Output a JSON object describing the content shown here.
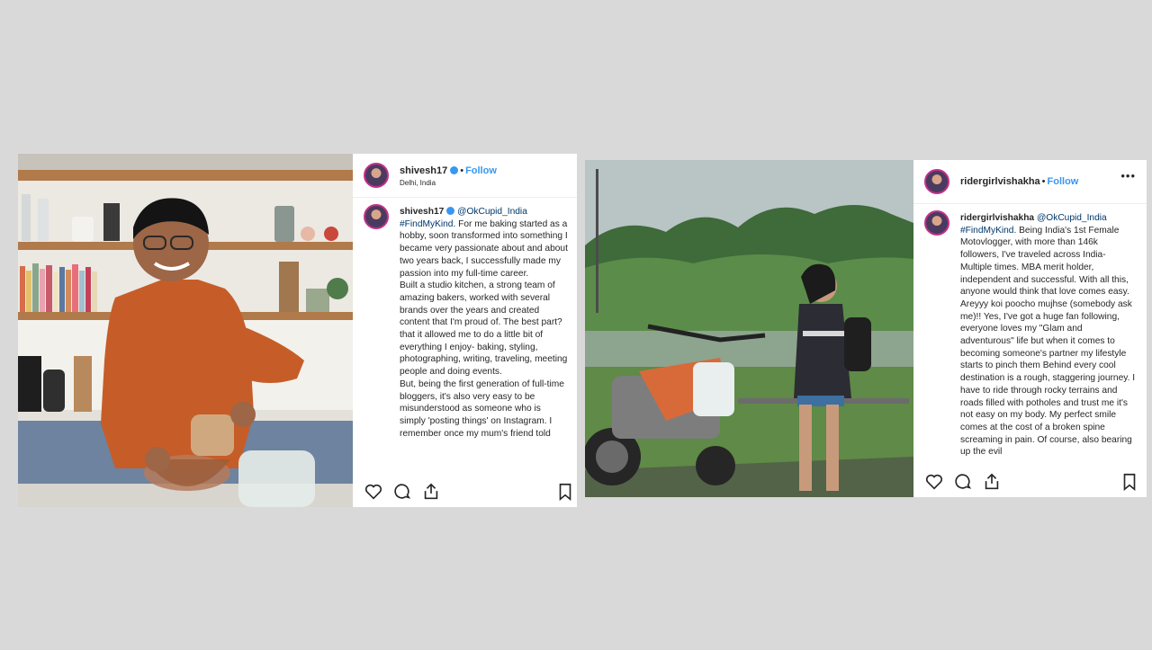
{
  "post_left": {
    "username": "shivesh17",
    "follow_label": "Follow",
    "location": "Delhi, India",
    "caption": {
      "username": "shivesh17",
      "mention": "@OkCupid_India",
      "hashtag": "#FindMyKind.",
      "paragraphs": [
        "For me baking started as a hobby, soon transformed into something I became very passionate about and about two years back, I successfully made my passion into my full-time career.",
        "Built a studio kitchen, a strong team of amazing bakers, worked with several brands over the years and created content that I'm proud of. The best part? that it allowed me to do a little bit of everything I enjoy- baking, styling, photographing, writing, traveling, meeting people and doing events.",
        "But, being the first generation of full-time bloggers, it's also very easy to be misunderstood as someone who is simply 'posting things' on Instagram. I remember once my mum's friend told"
      ]
    },
    "icons": [
      "heart-icon",
      "comment-icon",
      "share-icon",
      "bookmark-icon"
    ]
  },
  "post_right": {
    "username": "ridergirlvishakha",
    "follow_label": "Follow",
    "more_label": "•••",
    "caption": {
      "username": "ridergirlvishakha",
      "mention": "@OkCupid_India",
      "hashtag": "#FindMyKind.",
      "text": "Being India's 1st Female Motovlogger, with more than 146k followers, I've traveled across India- Multiple times. MBA merit holder, independent and successful. With all this, anyone would think that love comes easy. Areyyy koi poocho mujhse (somebody ask me)!! Yes, I've got a huge fan following, everyone loves my \"Glam and adventurous\" life but when it comes to becoming someone's partner my lifestyle starts to pinch them Behind every cool destination is a rough, staggering journey. I have to ride through rocky terrains and roads filled with potholes and trust me it's not easy on my body. My perfect smile comes at the cost of a broken spine screaming in pain. Of course, also bearing up the evil"
    },
    "icons": [
      "heart-icon",
      "comment-icon",
      "share-icon",
      "bookmark-icon"
    ]
  }
}
